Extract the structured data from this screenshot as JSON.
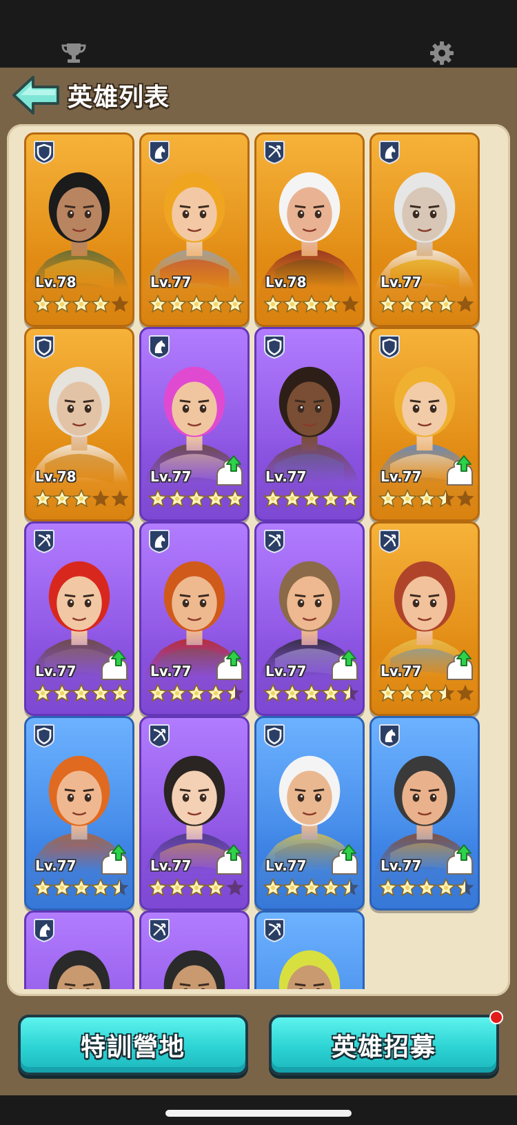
{
  "header": {
    "title": "英雄列表"
  },
  "top_icons": [
    "trophy-icon",
    "gear-icon"
  ],
  "colors": {
    "legendary": "#e08a12",
    "epic": "#8a52e0",
    "rare": "#3f86e6",
    "button": "#2cd3d3",
    "panel": "#efe3c6",
    "frame": "#7a6448"
  },
  "heroes": [
    {
      "level": "Lv.78",
      "rarity": "legendary",
      "role": "shield",
      "stars": 4,
      "upgrade": false,
      "skin": "#b98560",
      "hair": "#1b1b1b",
      "outfit": "#556b3a",
      "accent": "#e0b030"
    },
    {
      "level": "Lv.77",
      "rarity": "legendary",
      "role": "horse",
      "stars": 5,
      "upgrade": false,
      "skin": "#f2c9a4",
      "hair": "#f0a520",
      "outfit": "#9aa3ad",
      "accent": "#c0392b"
    },
    {
      "level": "Lv.78",
      "rarity": "legendary",
      "role": "bow",
      "stars": 4,
      "upgrade": false,
      "skin": "#e9b393",
      "hair": "#f4f4f4",
      "outfit": "#8e2a24",
      "accent": "#4a2a1a"
    },
    {
      "level": "Lv.77",
      "rarity": "legendary",
      "role": "horse",
      "stars": 4,
      "upgrade": false,
      "skin": "#d8c7b6",
      "hair": "#e6e6e6",
      "outfit": "#f3f3f3",
      "accent": "#e8c020"
    },
    {
      "level": "Lv.78",
      "rarity": "legendary",
      "role": "shield",
      "stars": 3,
      "upgrade": false,
      "skin": "#e3c3a6",
      "hair": "#e6e2dc",
      "outfit": "#f2f2f2",
      "accent": "#c8903a"
    },
    {
      "level": "Lv.77",
      "rarity": "epic",
      "role": "horse",
      "stars": 5,
      "upgrade": true,
      "skin": "#f0c6a0",
      "hair": "#e04ad0",
      "outfit": "#6a4a38",
      "accent": "#f0d090"
    },
    {
      "level": "Lv.77",
      "rarity": "epic",
      "role": "shield",
      "stars": 5,
      "upgrade": false,
      "skin": "#7a4e34",
      "hair": "#2d1f18",
      "outfit": "#6a4a3a",
      "accent": "#5a6470"
    },
    {
      "level": "Lv.77",
      "rarity": "legendary",
      "role": "shield",
      "stars": 3.5,
      "upgrade": true,
      "skin": "#f2cca8",
      "hair": "#f0b030",
      "outfit": "#5a8ad0",
      "accent": "#f4f4f4"
    },
    {
      "level": "Lv.77",
      "rarity": "epic",
      "role": "bow",
      "stars": 5,
      "upgrade": true,
      "skin": "#f2c8a4",
      "hair": "#d8281e",
      "outfit": "#6a4a30",
      "accent": "#8a6a40"
    },
    {
      "level": "Lv.77",
      "rarity": "epic",
      "role": "horse",
      "stars": 4.5,
      "upgrade": true,
      "skin": "#efb990",
      "hair": "#d05a1a",
      "outfit": "#c0281e",
      "accent": "#8a4a1a"
    },
    {
      "level": "Lv.77",
      "rarity": "epic",
      "role": "bow",
      "stars": 4.5,
      "upgrade": true,
      "skin": "#eeb890",
      "hair": "#8a6a48",
      "outfit": "#2a2a2e",
      "accent": "#a0a8b0"
    },
    {
      "level": "Lv.77",
      "rarity": "legendary",
      "role": "bow",
      "stars": 3.5,
      "upgrade": true,
      "skin": "#f2c29c",
      "hair": "#b0442a",
      "outfit": "#e8c050",
      "accent": "#5aa0e0"
    },
    {
      "level": "Lv.77",
      "rarity": "rare",
      "role": "shield",
      "stars": 4.5,
      "upgrade": true,
      "skin": "#f0b890",
      "hair": "#e06a20",
      "outfit": "#b86030",
      "accent": "#d8541a"
    },
    {
      "level": "Lv.77",
      "rarity": "epic",
      "role": "bow",
      "stars": 4,
      "upgrade": true,
      "skin": "#f4d0b4",
      "hair": "#2a2422",
      "outfit": "#4a3a80",
      "accent": "#e0a830"
    },
    {
      "level": "Lv.77",
      "rarity": "rare",
      "role": "shield",
      "stars": 4.5,
      "upgrade": true,
      "skin": "#eab890",
      "hair": "#f4f4f4",
      "outfit": "#d8c050",
      "accent": "#c89a30"
    },
    {
      "level": "Lv.77",
      "rarity": "rare",
      "role": "horse",
      "stars": 4.5,
      "upgrade": true,
      "skin": "#eab28c",
      "hair": "#3a3a3a",
      "outfit": "#8a4a2a",
      "accent": "#e8a020"
    },
    {
      "level": "",
      "rarity": "epic",
      "role": "horse",
      "stars": 0,
      "upgrade": false,
      "partial": true,
      "skin": "#c99a70",
      "hair": "#2a2a2a",
      "outfit": "#6a4a3a",
      "accent": "#e8c050"
    },
    {
      "level": "",
      "rarity": "epic",
      "role": "bow",
      "stars": 0,
      "upgrade": false,
      "partial": true,
      "skin": "#c99a70",
      "hair": "#2a2a2a",
      "outfit": "#9a2020",
      "accent": "#9a2020"
    },
    {
      "level": "",
      "rarity": "rare",
      "role": "bow",
      "stars": 0,
      "upgrade": false,
      "partial": true,
      "skin": "#c99a70",
      "hair": "#d8e040",
      "outfit": "#6a4a3a",
      "accent": "#d8e040"
    }
  ],
  "buttons": {
    "training": "特訓營地",
    "recruit": "英雄招募"
  },
  "recruit_notification": true
}
